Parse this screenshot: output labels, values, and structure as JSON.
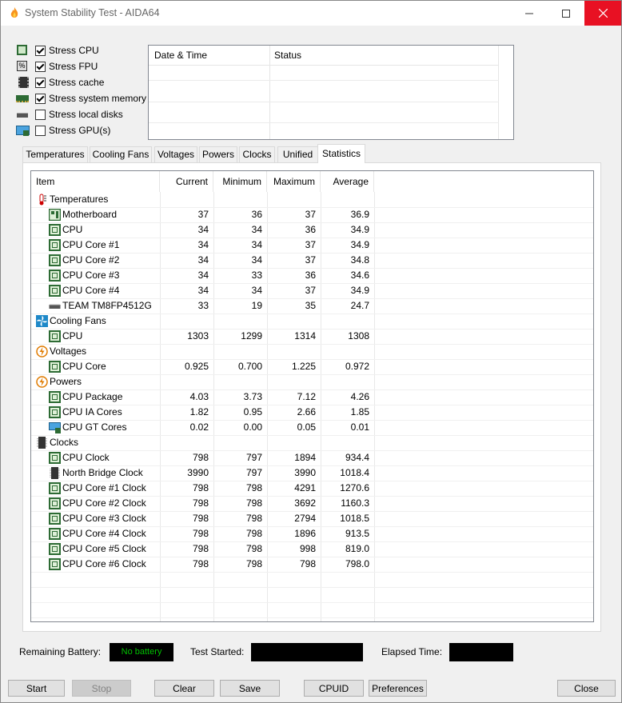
{
  "window": {
    "title": "System Stability Test - AIDA64"
  },
  "stress_options": [
    {
      "label": "Stress CPU",
      "checked": true,
      "icon": "cpu-chip-icon"
    },
    {
      "label": "Stress FPU",
      "checked": true,
      "icon": "fpu-icon"
    },
    {
      "label": "Stress cache",
      "checked": true,
      "icon": "cache-icon"
    },
    {
      "label": "Stress system memory",
      "checked": true,
      "icon": "memory-icon"
    },
    {
      "label": "Stress local disks",
      "checked": false,
      "icon": "disk-icon"
    },
    {
      "label": "Stress GPU(s)",
      "checked": false,
      "icon": "gpu-icon"
    }
  ],
  "log": {
    "col_date": "Date & Time",
    "col_status": "Status"
  },
  "tabs": [
    "Temperatures",
    "Cooling Fans",
    "Voltages",
    "Powers",
    "Clocks",
    "Unified",
    "Statistics"
  ],
  "active_tab": "Statistics",
  "stats": {
    "headers": {
      "item": "Item",
      "current": "Current",
      "minimum": "Minimum",
      "maximum": "Maximum",
      "average": "Average"
    },
    "rows": [
      {
        "type": "group",
        "label": "Temperatures",
        "icon": "thermometer-icon"
      },
      {
        "type": "item",
        "label": "Motherboard",
        "icon": "motherboard-icon",
        "current": "37",
        "min": "36",
        "max": "37",
        "avg": "36.9"
      },
      {
        "type": "item",
        "label": "CPU",
        "icon": "cpu-chip-icon",
        "current": "34",
        "min": "34",
        "max": "36",
        "avg": "34.9"
      },
      {
        "type": "item",
        "label": "CPU Core #1",
        "icon": "cpu-chip-icon",
        "current": "34",
        "min": "34",
        "max": "37",
        "avg": "34.9"
      },
      {
        "type": "item",
        "label": "CPU Core #2",
        "icon": "cpu-chip-icon",
        "current": "34",
        "min": "34",
        "max": "37",
        "avg": "34.8"
      },
      {
        "type": "item",
        "label": "CPU Core #3",
        "icon": "cpu-chip-icon",
        "current": "34",
        "min": "33",
        "max": "36",
        "avg": "34.6"
      },
      {
        "type": "item",
        "label": "CPU Core #4",
        "icon": "cpu-chip-icon",
        "current": "34",
        "min": "34",
        "max": "37",
        "avg": "34.9"
      },
      {
        "type": "item",
        "label": "TEAM TM8FP4512G",
        "icon": "disk-icon",
        "current": "33",
        "min": "19",
        "max": "35",
        "avg": "24.7"
      },
      {
        "type": "group",
        "label": "Cooling Fans",
        "icon": "fan-icon"
      },
      {
        "type": "item",
        "label": "CPU",
        "icon": "cpu-chip-icon",
        "current": "1303",
        "min": "1299",
        "max": "1314",
        "avg": "1308"
      },
      {
        "type": "group",
        "label": "Voltages",
        "icon": "voltage-icon"
      },
      {
        "type": "item",
        "label": "CPU Core",
        "icon": "cpu-chip-icon",
        "current": "0.925",
        "min": "0.700",
        "max": "1.225",
        "avg": "0.972"
      },
      {
        "type": "group",
        "label": "Powers",
        "icon": "power-icon"
      },
      {
        "type": "item",
        "label": "CPU Package",
        "icon": "cpu-chip-icon",
        "current": "4.03",
        "min": "3.73",
        "max": "7.12",
        "avg": "4.26"
      },
      {
        "type": "item",
        "label": "CPU IA Cores",
        "icon": "cpu-chip-icon",
        "current": "1.82",
        "min": "0.95",
        "max": "2.66",
        "avg": "1.85"
      },
      {
        "type": "item",
        "label": "CPU GT Cores",
        "icon": "gpu-icon",
        "current": "0.02",
        "min": "0.00",
        "max": "0.05",
        "avg": "0.01"
      },
      {
        "type": "group",
        "label": "Clocks",
        "icon": "clock-icon"
      },
      {
        "type": "item",
        "label": "CPU Clock",
        "icon": "cpu-chip-icon",
        "current": "798",
        "min": "797",
        "max": "1894",
        "avg": "934.4"
      },
      {
        "type": "item",
        "label": "North Bridge Clock",
        "icon": "northbridge-icon",
        "current": "3990",
        "min": "797",
        "max": "3990",
        "avg": "1018.4"
      },
      {
        "type": "item",
        "label": "CPU Core #1 Clock",
        "icon": "cpu-chip-icon",
        "current": "798",
        "min": "798",
        "max": "4291",
        "avg": "1270.6"
      },
      {
        "type": "item",
        "label": "CPU Core #2 Clock",
        "icon": "cpu-chip-icon",
        "current": "798",
        "min": "798",
        "max": "3692",
        "avg": "1160.3"
      },
      {
        "type": "item",
        "label": "CPU Core #3 Clock",
        "icon": "cpu-chip-icon",
        "current": "798",
        "min": "798",
        "max": "2794",
        "avg": "1018.5"
      },
      {
        "type": "item",
        "label": "CPU Core #4 Clock",
        "icon": "cpu-chip-icon",
        "current": "798",
        "min": "798",
        "max": "1896",
        "avg": "913.5"
      },
      {
        "type": "item",
        "label": "CPU Core #5 Clock",
        "icon": "cpu-chip-icon",
        "current": "798",
        "min": "798",
        "max": "998",
        "avg": "819.0"
      },
      {
        "type": "item",
        "label": "CPU Core #6 Clock",
        "icon": "cpu-chip-icon",
        "current": "798",
        "min": "798",
        "max": "798",
        "avg": "798.0"
      }
    ]
  },
  "status": {
    "battery_label": "Remaining Battery:",
    "battery_value": "No battery",
    "battery_color": "#00c000",
    "test_started_label": "Test Started:",
    "elapsed_label": "Elapsed Time:"
  },
  "buttons": {
    "start": "Start",
    "stop": "Stop",
    "clear": "Clear",
    "save": "Save",
    "cpuid": "CPUID",
    "preferences": "Preferences",
    "close": "Close"
  }
}
